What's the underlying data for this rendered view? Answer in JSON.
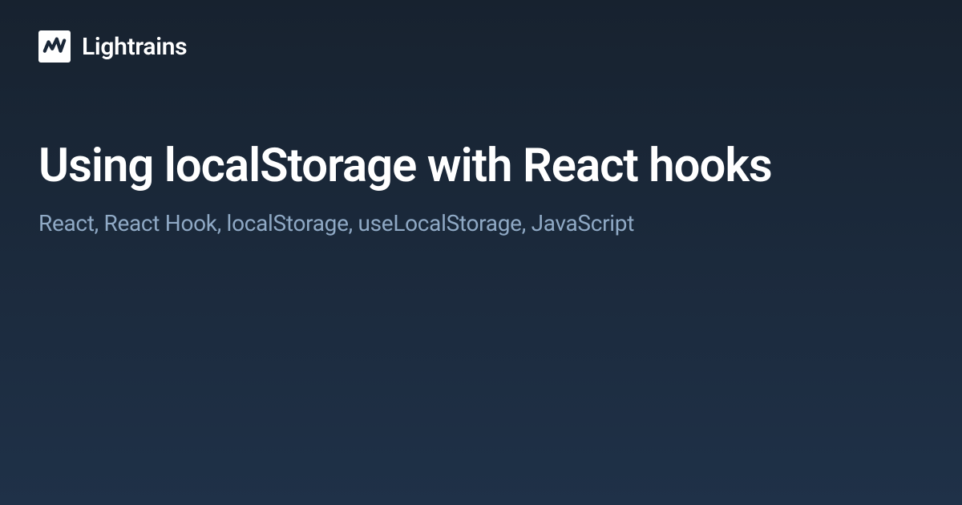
{
  "header": {
    "brand_name": "Lightrains"
  },
  "content": {
    "title": "Using localStorage with React hooks",
    "tags": "React, React Hook, localStorage, useLocalStorage, JavaScript"
  }
}
